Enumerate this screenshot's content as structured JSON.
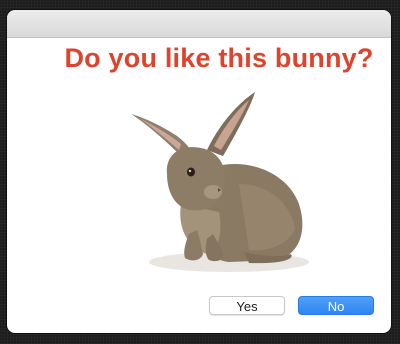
{
  "dialog": {
    "question": "Do you like this bunny?",
    "accent_color": "#e0432d",
    "image": {
      "subject": "brown rabbit",
      "icon": "bunny-photo"
    }
  },
  "buttons": {
    "yes_label": "Yes",
    "no_label": "No",
    "default_color": "#2f86f3"
  }
}
